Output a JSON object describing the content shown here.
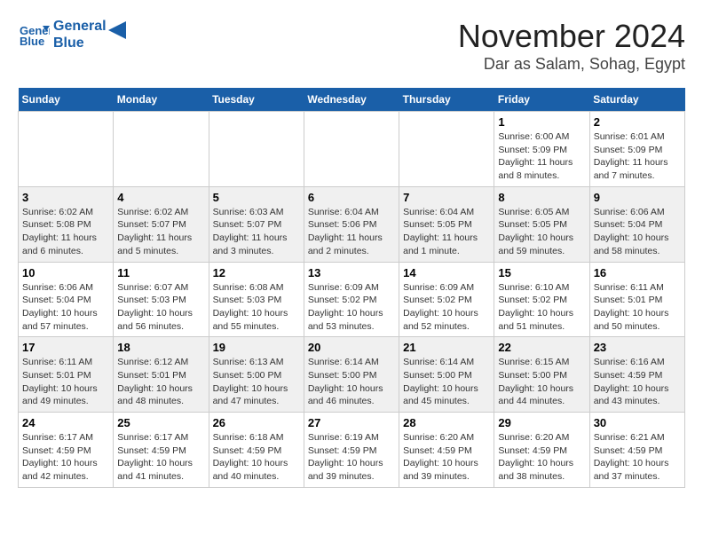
{
  "header": {
    "logo_line1": "General",
    "logo_line2": "Blue",
    "month_title": "November 2024",
    "location": "Dar as Salam, Sohag, Egypt"
  },
  "weekdays": [
    "Sunday",
    "Monday",
    "Tuesday",
    "Wednesday",
    "Thursday",
    "Friday",
    "Saturday"
  ],
  "weeks": [
    {
      "days": [
        {
          "num": "",
          "info": ""
        },
        {
          "num": "",
          "info": ""
        },
        {
          "num": "",
          "info": ""
        },
        {
          "num": "",
          "info": ""
        },
        {
          "num": "",
          "info": ""
        },
        {
          "num": "1",
          "info": "Sunrise: 6:00 AM\nSunset: 5:09 PM\nDaylight: 11 hours\nand 8 minutes."
        },
        {
          "num": "2",
          "info": "Sunrise: 6:01 AM\nSunset: 5:09 PM\nDaylight: 11 hours\nand 7 minutes."
        }
      ]
    },
    {
      "days": [
        {
          "num": "3",
          "info": "Sunrise: 6:02 AM\nSunset: 5:08 PM\nDaylight: 11 hours\nand 6 minutes."
        },
        {
          "num": "4",
          "info": "Sunrise: 6:02 AM\nSunset: 5:07 PM\nDaylight: 11 hours\nand 5 minutes."
        },
        {
          "num": "5",
          "info": "Sunrise: 6:03 AM\nSunset: 5:07 PM\nDaylight: 11 hours\nand 3 minutes."
        },
        {
          "num": "6",
          "info": "Sunrise: 6:04 AM\nSunset: 5:06 PM\nDaylight: 11 hours\nand 2 minutes."
        },
        {
          "num": "7",
          "info": "Sunrise: 6:04 AM\nSunset: 5:05 PM\nDaylight: 11 hours\nand 1 minute."
        },
        {
          "num": "8",
          "info": "Sunrise: 6:05 AM\nSunset: 5:05 PM\nDaylight: 10 hours\nand 59 minutes."
        },
        {
          "num": "9",
          "info": "Sunrise: 6:06 AM\nSunset: 5:04 PM\nDaylight: 10 hours\nand 58 minutes."
        }
      ]
    },
    {
      "days": [
        {
          "num": "10",
          "info": "Sunrise: 6:06 AM\nSunset: 5:04 PM\nDaylight: 10 hours\nand 57 minutes."
        },
        {
          "num": "11",
          "info": "Sunrise: 6:07 AM\nSunset: 5:03 PM\nDaylight: 10 hours\nand 56 minutes."
        },
        {
          "num": "12",
          "info": "Sunrise: 6:08 AM\nSunset: 5:03 PM\nDaylight: 10 hours\nand 55 minutes."
        },
        {
          "num": "13",
          "info": "Sunrise: 6:09 AM\nSunset: 5:02 PM\nDaylight: 10 hours\nand 53 minutes."
        },
        {
          "num": "14",
          "info": "Sunrise: 6:09 AM\nSunset: 5:02 PM\nDaylight: 10 hours\nand 52 minutes."
        },
        {
          "num": "15",
          "info": "Sunrise: 6:10 AM\nSunset: 5:02 PM\nDaylight: 10 hours\nand 51 minutes."
        },
        {
          "num": "16",
          "info": "Sunrise: 6:11 AM\nSunset: 5:01 PM\nDaylight: 10 hours\nand 50 minutes."
        }
      ]
    },
    {
      "days": [
        {
          "num": "17",
          "info": "Sunrise: 6:11 AM\nSunset: 5:01 PM\nDaylight: 10 hours\nand 49 minutes."
        },
        {
          "num": "18",
          "info": "Sunrise: 6:12 AM\nSunset: 5:01 PM\nDaylight: 10 hours\nand 48 minutes."
        },
        {
          "num": "19",
          "info": "Sunrise: 6:13 AM\nSunset: 5:00 PM\nDaylight: 10 hours\nand 47 minutes."
        },
        {
          "num": "20",
          "info": "Sunrise: 6:14 AM\nSunset: 5:00 PM\nDaylight: 10 hours\nand 46 minutes."
        },
        {
          "num": "21",
          "info": "Sunrise: 6:14 AM\nSunset: 5:00 PM\nDaylight: 10 hours\nand 45 minutes."
        },
        {
          "num": "22",
          "info": "Sunrise: 6:15 AM\nSunset: 5:00 PM\nDaylight: 10 hours\nand 44 minutes."
        },
        {
          "num": "23",
          "info": "Sunrise: 6:16 AM\nSunset: 4:59 PM\nDaylight: 10 hours\nand 43 minutes."
        }
      ]
    },
    {
      "days": [
        {
          "num": "24",
          "info": "Sunrise: 6:17 AM\nSunset: 4:59 PM\nDaylight: 10 hours\nand 42 minutes."
        },
        {
          "num": "25",
          "info": "Sunrise: 6:17 AM\nSunset: 4:59 PM\nDaylight: 10 hours\nand 41 minutes."
        },
        {
          "num": "26",
          "info": "Sunrise: 6:18 AM\nSunset: 4:59 PM\nDaylight: 10 hours\nand 40 minutes."
        },
        {
          "num": "27",
          "info": "Sunrise: 6:19 AM\nSunset: 4:59 PM\nDaylight: 10 hours\nand 39 minutes."
        },
        {
          "num": "28",
          "info": "Sunrise: 6:20 AM\nSunset: 4:59 PM\nDaylight: 10 hours\nand 39 minutes."
        },
        {
          "num": "29",
          "info": "Sunrise: 6:20 AM\nSunset: 4:59 PM\nDaylight: 10 hours\nand 38 minutes."
        },
        {
          "num": "30",
          "info": "Sunrise: 6:21 AM\nSunset: 4:59 PM\nDaylight: 10 hours\nand 37 minutes."
        }
      ]
    }
  ]
}
